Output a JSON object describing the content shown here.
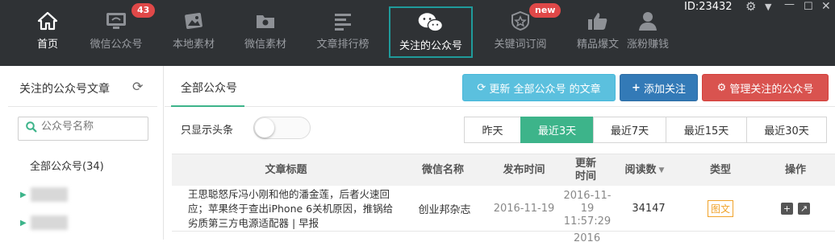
{
  "nav": {
    "items": [
      {
        "label": "首页",
        "icon": "home-icon"
      },
      {
        "label": "微信公众号",
        "icon": "monitor-icon",
        "badge": "43"
      },
      {
        "label": "本地素材",
        "icon": "image-icon"
      },
      {
        "label": "微信素材",
        "icon": "folder-icon"
      },
      {
        "label": "文章排行榜",
        "icon": "ranking-icon"
      },
      {
        "label": "关注的公众号",
        "icon": "wechat-icon"
      },
      {
        "label": "关键词订阅",
        "icon": "badge-star-icon",
        "badge": "new"
      },
      {
        "label": "精品爆文",
        "icon": "thumbs-up-icon"
      },
      {
        "label": "涨粉赚钱",
        "icon": "user-icon"
      }
    ],
    "id_label": "ID:23432"
  },
  "sidebar": {
    "title": "关注的公众号文章",
    "search_placeholder": "公众号名称",
    "all_label": "全部公众号(34)"
  },
  "main": {
    "tab_all": "全部公众号",
    "refresh_button": "更新 全部公众号 的文章",
    "add_button": "添加关注",
    "manage_button": "管理关注的公众号",
    "toggle_label": "只显示头条",
    "ranges": [
      "昨天",
      "最近3天",
      "最近7天",
      "最近15天",
      "最近30天"
    ],
    "active_range": "最近3天"
  },
  "table": {
    "headers": [
      "文章标题",
      "微信名称",
      "发布时间",
      "更新时间",
      "阅读数",
      "类型",
      "操作"
    ],
    "rows": [
      {
        "title": "王思聪怒斥冯小刚和他的潘金莲，后者火速回应；苹果终于查出iPhone 6关机原因，推锅给劣质第三方电源适配器 | 早报",
        "account": "创业邦杂志",
        "published": "2016-11-19",
        "updated_date": "2016-11-19",
        "updated_time": "11:57:29",
        "reads": "34147",
        "type": "图文"
      }
    ],
    "next_row_partial": "2016"
  },
  "colors": {
    "topbar": "#2f3235",
    "accent_green": "#3db48a",
    "active_border": "#1f9b9b",
    "badge_red": "#e04848"
  }
}
